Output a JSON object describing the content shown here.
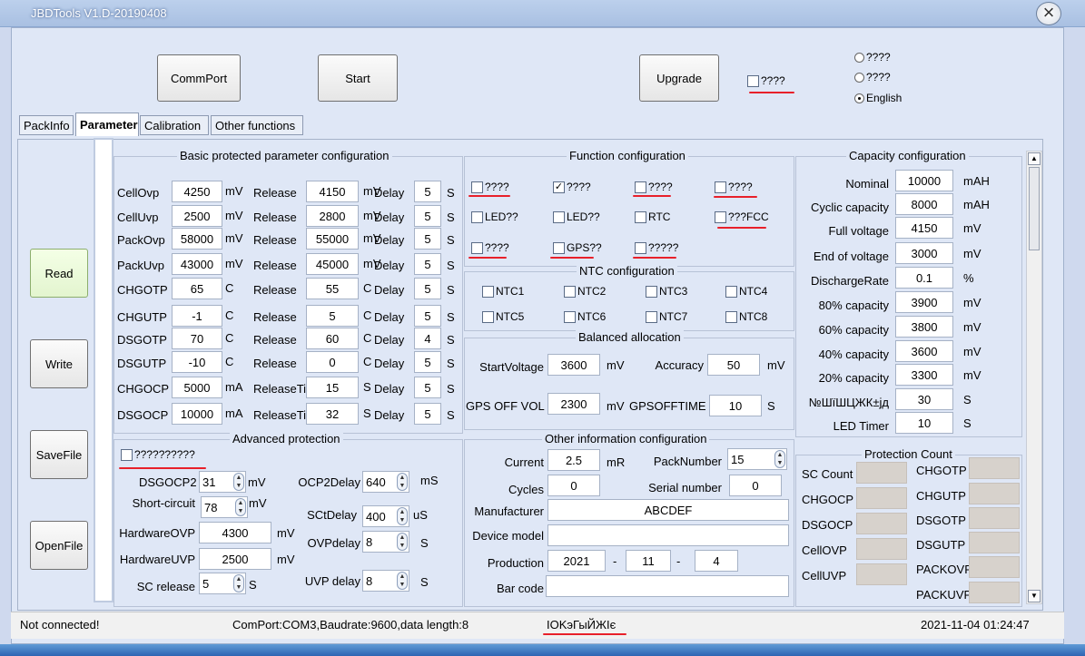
{
  "window": {
    "title": "JBDTools V1.D-20190408"
  },
  "toolbar": {
    "commport": "CommPort",
    "start": "Start",
    "upgrade": "Upgrade",
    "upgrade_check": "????"
  },
  "language": [
    {
      "label": "????",
      "selected": false
    },
    {
      "label": "????",
      "selected": false
    },
    {
      "label": "English",
      "selected": true
    }
  ],
  "tabs": [
    "PackInfo",
    "Parameter",
    "Calibration",
    "Other functions"
  ],
  "side_buttons": {
    "read": "Read",
    "write": "Write",
    "savefile": "SaveFile",
    "openfile": "OpenFile"
  },
  "basic": {
    "title": "Basic protected parameter configuration",
    "rows": [
      {
        "name": "CellOvp",
        "value": "4250",
        "unit": "mV",
        "rel_label": "Release",
        "release": "4150",
        "rel_unit": "mV",
        "delay_label": "Delay",
        "delay": "5",
        "delay_unit": "S"
      },
      {
        "name": "CellUvp",
        "value": "2500",
        "unit": "mV",
        "rel_label": "Release",
        "release": "2800",
        "rel_unit": "mV",
        "delay_label": "Delay",
        "delay": "5",
        "delay_unit": "S"
      },
      {
        "name": "PackOvp",
        "value": "58000",
        "unit": "mV",
        "rel_label": "Release",
        "release": "55000",
        "rel_unit": "mV",
        "delay_label": "Delay",
        "delay": "5",
        "delay_unit": "S"
      },
      {
        "name": "PackUvp",
        "value": "43000",
        "unit": "mV",
        "rel_label": "Release",
        "release": "45000",
        "rel_unit": "mV",
        "delay_label": "Delay",
        "delay": "5",
        "delay_unit": "S"
      },
      {
        "name": "CHGOTP",
        "value": "65",
        "unit": "C",
        "rel_label": "Release",
        "release": "55",
        "rel_unit": "C",
        "delay_label": "Delay",
        "delay": "5",
        "delay_unit": "S"
      },
      {
        "name": "CHGUTP",
        "value": "-1",
        "unit": "C",
        "rel_label": "Release",
        "release": "5",
        "rel_unit": "C",
        "delay_label": "Delay",
        "delay": "5",
        "delay_unit": "S"
      },
      {
        "name": "DSGOTP",
        "value": "70",
        "unit": "C",
        "rel_label": "Release",
        "release": "60",
        "rel_unit": "C",
        "delay_label": "Delay",
        "delay": "4",
        "delay_unit": "S"
      },
      {
        "name": "DSGUTP",
        "value": "-10",
        "unit": "C",
        "rel_label": "Release",
        "release": "0",
        "rel_unit": "C",
        "delay_label": "Delay",
        "delay": "5",
        "delay_unit": "S"
      },
      {
        "name": "CHGOCP",
        "value": "5000",
        "unit": "mA",
        "rel_label": "ReleaseTir",
        "release": "15",
        "rel_unit": "S",
        "delay_label": "Delay",
        "delay": "5",
        "delay_unit": "S"
      },
      {
        "name": "DSGOCP",
        "value": "10000",
        "unit": "mA",
        "rel_label": "ReleaseTir",
        "release": "32",
        "rel_unit": "S",
        "delay_label": "Delay",
        "delay": "5",
        "delay_unit": "S"
      }
    ]
  },
  "function_cfg": {
    "title": "Function configuration",
    "items": [
      {
        "label": "????",
        "checked": false
      },
      {
        "label": "????",
        "checked": true
      },
      {
        "label": "????",
        "checked": false
      },
      {
        "label": "????",
        "checked": false
      },
      {
        "label": "LED??",
        "checked": false
      },
      {
        "label": "LED??",
        "checked": false
      },
      {
        "label": "RTC",
        "checked": false
      },
      {
        "label": "???FCC",
        "checked": false
      },
      {
        "label": "????",
        "checked": false
      },
      {
        "label": "GPS??",
        "checked": false
      },
      {
        "label": "?????",
        "checked": false
      }
    ]
  },
  "ntc": {
    "title": "NTC configuration",
    "items": [
      "NTC1",
      "NTC2",
      "NTC3",
      "NTC4",
      "NTC5",
      "NTC6",
      "NTC7",
      "NTC8"
    ]
  },
  "balance": {
    "title": "Balanced allocation",
    "start_voltage_label": "StartVoltage",
    "start_voltage": "3600",
    "start_voltage_unit": "mV",
    "accuracy_label": "Accuracy",
    "accuracy": "50",
    "accuracy_unit": "mV",
    "gps_off_vol_label": "GPS OFF VOL",
    "gps_off_vol": "2300",
    "gps_off_vol_unit": "mV",
    "gps_off_time_label": "GPSOFFTIME",
    "gps_off_time": "10",
    "gps_off_time_unit": "S"
  },
  "capacity": {
    "title": "Capacity configuration",
    "rows": [
      {
        "label": "Nominal",
        "value": "10000",
        "unit": "mAH"
      },
      {
        "label": "Cyclic capacity",
        "value": "8000",
        "unit": "mAH"
      },
      {
        "label": "Full voltage",
        "value": "4150",
        "unit": "mV"
      },
      {
        "label": "End of voltage",
        "value": "3000",
        "unit": "mV"
      },
      {
        "label": "DischargeRate",
        "value": "0.1",
        "unit": "%"
      },
      {
        "label": "80% capacity",
        "value": "3900",
        "unit": "mV"
      },
      {
        "label": "60% capacity",
        "value": "3800",
        "unit": "mV"
      },
      {
        "label": "40% capacity",
        "value": "3600",
        "unit": "mV"
      },
      {
        "label": "20% capacity",
        "value": "3300",
        "unit": "mV"
      },
      {
        "label": "№ШїШЦЖК±јд",
        "value": "30",
        "unit": "S"
      },
      {
        "label": "LED Timer",
        "value": "10",
        "unit": "S"
      }
    ]
  },
  "advanced": {
    "title": "Advanced protection",
    "enable_label": "??????????",
    "dsgocp2_label": "DSGOCP2",
    "dsgocp2": "31",
    "dsgocp2_unit": "mV",
    "short_label": "Short-circuit",
    "short": "78",
    "short_unit": "mV",
    "hw_ovp_label": "HardwareOVP",
    "hw_ovp": "4300",
    "hw_ovp_unit": "mV",
    "hw_uvp_label": "HardwareUVP",
    "hw_uvp": "2500",
    "hw_uvp_unit": "mV",
    "sc_release_label": "SC release",
    "sc_release": "5",
    "sc_release_unit": "S",
    "ocp2_delay_label": "OCP2Delay",
    "ocp2_delay": "640",
    "ocp2_delay_unit": "mS",
    "sct_delay_label": "SCtDelay",
    "sct_delay": "400",
    "sct_delay_unit": "uS",
    "ovp_delay_label": "OVPdelay",
    "ovp_delay": "8",
    "ovp_delay_unit": "S",
    "uvp_delay_label": "UVP delay",
    "uvp_delay": "8",
    "uvp_delay_unit": "S"
  },
  "other_info": {
    "title": "Other information configuration",
    "current_label": "Current",
    "current": "2.5",
    "current_unit": "mR",
    "pack_number_label": "PackNumber",
    "pack_number": "15",
    "cycles_label": "Cycles",
    "cycles": "0",
    "serial_label": "Serial number",
    "serial": "0",
    "manufacturer_label": "Manufacturer",
    "manufacturer": "ABCDEF",
    "device_model_label": "Device model",
    "device_model": "",
    "production_label": "Production",
    "prod_year": "2021",
    "prod_month": "11",
    "prod_day": "4",
    "date_sep": "-",
    "barcode_label": "Bar code",
    "barcode": ""
  },
  "protection_count": {
    "title": "Protection Count",
    "left": [
      "SC Count",
      "CHGOCP",
      "DSGOCP",
      "CellOVP",
      "CellUVP"
    ],
    "right": [
      "CHGOTP",
      "CHGUTP",
      "DSGOTP",
      "DSGUTP",
      "PACKOVP",
      "PACKUVP"
    ]
  },
  "status": {
    "connection": "Not connected!",
    "port_info": "ComPort:COM3,Baudrate:9600,data length:8",
    "garbled": "IOKэГыЙЖІє",
    "datetime": "2021-11-04 01:24:47"
  },
  "colors": {
    "annotation": "#e8202a",
    "window_bg": "#dfe7f6"
  }
}
